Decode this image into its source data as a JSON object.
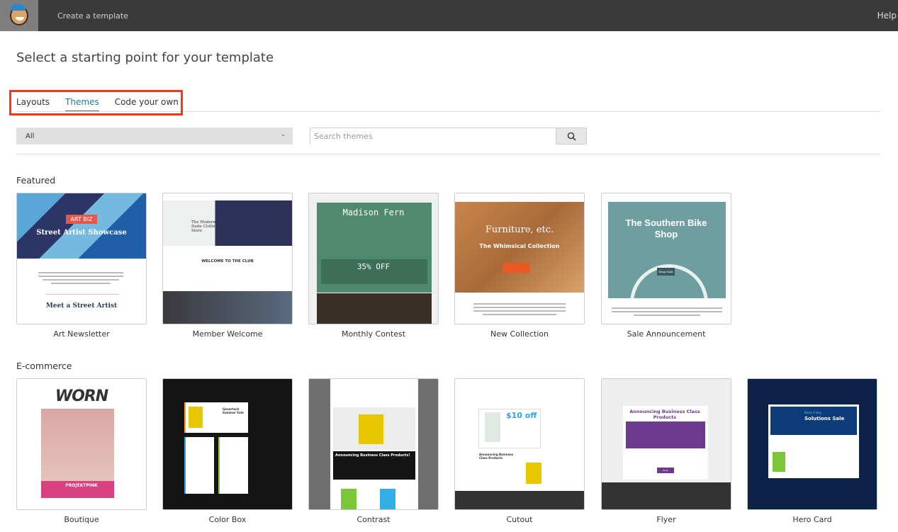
{
  "header": {
    "breadcrumb": "Create a template",
    "help": "Help"
  },
  "page_title": "Select a starting point for your template",
  "tabs": [
    {
      "label": "Layouts",
      "active": false
    },
    {
      "label": "Themes",
      "active": true
    },
    {
      "label": "Code your own",
      "active": false
    }
  ],
  "filter": {
    "selected": "All"
  },
  "search": {
    "placeholder": "Search themes",
    "value": ""
  },
  "sections": {
    "featured": {
      "title": "Featured",
      "items": [
        {
          "name": "Art Newsletter",
          "headline": "Street Artist Showcase",
          "sub": "Meet a Street Artist",
          "logo": "ART BIZ"
        },
        {
          "name": "Member Welcome",
          "headline": "WELCOME TO THE CLUB",
          "sub": "The Modern Dude Clothing Store"
        },
        {
          "name": "Monthly Contest",
          "headline": "Madison Fern",
          "sub": "35% OFF"
        },
        {
          "name": "New Collection",
          "headline": "Furniture, etc.",
          "sub": "The Whimsical Collection"
        },
        {
          "name": "Sale Announcement",
          "headline": "The Southern Bike Shop",
          "sub": "Shop Sale"
        }
      ]
    },
    "ecommerce": {
      "title": "E-commerce",
      "items": [
        {
          "name": "Boutique",
          "headline": "WORN",
          "sub": "PROJEKTPINK"
        },
        {
          "name": "Color Box",
          "headline": "Genertech Summer Sale",
          "sub": ""
        },
        {
          "name": "Contrast",
          "headline": "Announcing Business Class Products!",
          "sub": ""
        },
        {
          "name": "Cutout",
          "headline": "$10 off",
          "sub": "Announcing Business Class Products"
        },
        {
          "name": "Flyer",
          "headline": "Announcing Business Class Products",
          "sub": "Shop Genertech"
        },
        {
          "name": "Hero Card",
          "headline": "Solutions Sale",
          "sub": "Black Friday"
        }
      ]
    }
  },
  "colors": {
    "accent": "#1f7aa0",
    "highlight_box": "#f03a17",
    "topbar": "#3a3a3a"
  }
}
